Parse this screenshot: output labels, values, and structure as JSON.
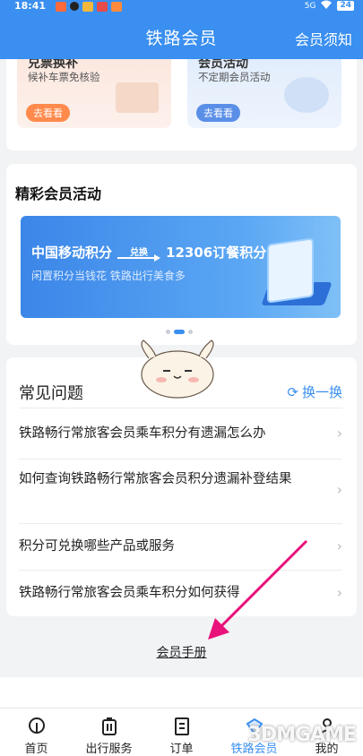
{
  "status": {
    "time": "18:41",
    "signal": "5G",
    "battery": "24"
  },
  "nav": {
    "title": "铁路会员",
    "right_link": "会员须知"
  },
  "promos": [
    {
      "title": "兑票换补",
      "subtitle": "候补车票免核验",
      "button": "去看看"
    },
    {
      "title": "会员活动",
      "subtitle": "不定期会员活动",
      "button": "去看看"
    }
  ],
  "activities": {
    "heading": "精彩会员活动",
    "banner": {
      "from": "中国移动积分",
      "arrow_label": "兑换",
      "to": "12306订餐积分",
      "slogan": "闲置积分当钱花 铁路出行美食多"
    }
  },
  "faq": {
    "heading": "常见问题",
    "refresh_label": "换一换",
    "items": [
      "铁路畅行常旅客会员乘车积分有遗漏怎么办",
      "如何查询铁路畅行常旅客会员积分遗漏补登结果",
      "积分可兑换哪些产品或服务",
      "铁路畅行常旅客会员乘车积分如何获得"
    ]
  },
  "manual_link": "会员手册",
  "tabs": [
    {
      "label": "首页",
      "icon": "home-icon"
    },
    {
      "label": "出行服务",
      "icon": "suitcase-icon"
    },
    {
      "label": "订单",
      "icon": "order-icon"
    },
    {
      "label": "铁路会员",
      "icon": "member-diamond-icon"
    },
    {
      "label": "我的",
      "icon": "profile-icon"
    }
  ],
  "watermark": "3DMGAME",
  "colors": {
    "brand": "#3a8ff0",
    "annotation": "#e8127a"
  }
}
